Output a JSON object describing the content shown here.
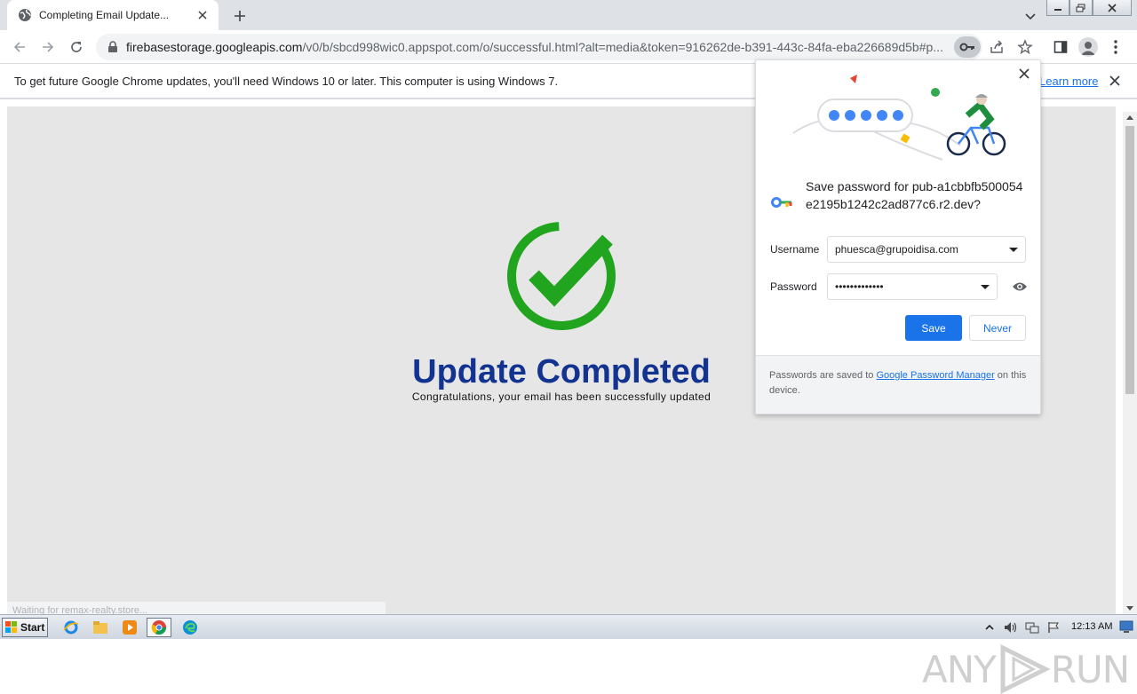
{
  "tab": {
    "title": "Completing Email Update..."
  },
  "toolbar": {
    "url_host": "firebasestorage.googleapis.com",
    "url_path": "/v0/b/sbcd998wic0.appspot.com/o/successful.html?alt=media&token=916262de-b391-443c-84fa-eba226689d5b#p..."
  },
  "infobar": {
    "message": "To get future Google Chrome updates, you'll need Windows 10 or later. This computer is using Windows 7.",
    "link": "Learn more"
  },
  "page": {
    "headline": "Update Completed",
    "subline": "Congratulations, your email has been successfully updated",
    "status": "Waiting for remax-realty.store...",
    "accent": "#22a51e",
    "headline_color": "#123490"
  },
  "bubble": {
    "title": "Save password for pub-a1cbbfb500054e2195b1242c2ad877c6.r2.dev?",
    "username_label": "Username",
    "username_value": "phuesca@grupoidisa.com",
    "password_label": "Password",
    "password_value": "•••••••••••••",
    "save_label": "Save",
    "never_label": "Never",
    "footer_prefix": "Passwords are saved to ",
    "footer_link": "Google Password Manager",
    "footer_suffix": " on this device."
  },
  "taskbar": {
    "start_label": "Start",
    "clock": "12:13 AM"
  },
  "watermark": {
    "left": "ANY",
    "right": "RUN"
  }
}
